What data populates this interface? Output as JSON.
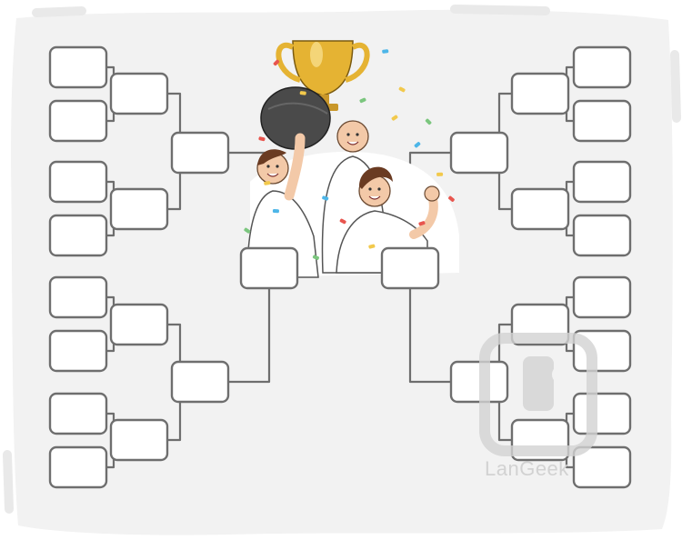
{
  "bracket": {
    "rounds_per_side": 4,
    "entrants_per_side": 8,
    "slot_stroke": "#6e6e6e",
    "slot_fill": "#ffffff",
    "line_color": "#6e6e6e",
    "panel_color": "#f2f2f2"
  },
  "illustration": {
    "subject": "three-celebrating-players-with-trophy",
    "trophy_color": "#e5b333",
    "ball_color": "#4a4a4a",
    "confetti_colors": [
      "#e8554e",
      "#4db6e8",
      "#f2c94c",
      "#7bc67e"
    ]
  },
  "watermark": {
    "text": "LanGeek",
    "color": "#d2d2d2"
  }
}
